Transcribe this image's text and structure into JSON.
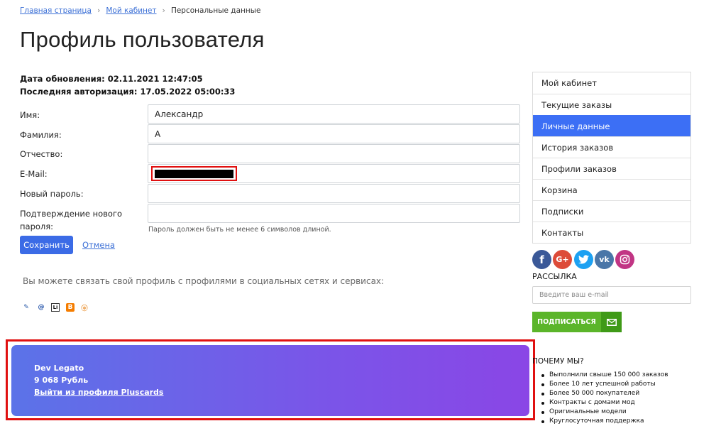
{
  "breadcrumb": {
    "home": "Главная страница",
    "cabinet": "Мой кабинет",
    "current": "Персональные данные"
  },
  "page_title": "Профиль пользователя",
  "meta": {
    "updated": "Дата обновления: 02.11.2021 12:47:05",
    "last_login": "Последняя авторизация: 17.05.2022 05:00:33"
  },
  "form": {
    "name_label": "Имя:",
    "name_value": "Александр",
    "surname_label": "Фамилия:",
    "surname_value": "А",
    "patronymic_label": "Отчество:",
    "patronymic_value": "",
    "email_label": "E-Mail:",
    "new_password_label": "Новый пароль:",
    "confirm_label_1": "Подтверждение нового",
    "confirm_label_2": "пароля:",
    "password_hint": "Пароль должен быть не менее 6 символов длиной.",
    "save": "Сохранить",
    "cancel": "Отмена"
  },
  "social": {
    "text": "Вы можете связать свой профиль с профилями в социальных сетях и сервисах:",
    "services": [
      "livejournal-icon",
      "mailru-icon",
      "liveinternet-icon",
      "blogger-icon",
      "openid-icon"
    ]
  },
  "profile_card": {
    "name": "Dev Legato",
    "balance": "9 068 Рубль",
    "logout": "Выйти из профиля Pluscards"
  },
  "sidebar": {
    "items": [
      {
        "label": "Мой кабинет"
      },
      {
        "label": "Текущие заказы"
      },
      {
        "label": "Личные данные",
        "active": true
      },
      {
        "label": "История заказов"
      },
      {
        "label": "Профили заказов"
      },
      {
        "label": "Корзина"
      },
      {
        "label": "Подписки"
      },
      {
        "label": "Контакты"
      }
    ],
    "social_links": [
      {
        "icon": "facebook-icon",
        "glyph": "f",
        "color": "#3b5998"
      },
      {
        "icon": "google-plus-icon",
        "glyph": "G+",
        "color": "#dd4b39"
      },
      {
        "icon": "twitter-icon",
        "glyph": "t",
        "color": "#1da1f2"
      },
      {
        "icon": "vk-icon",
        "glyph": "vk",
        "color": "#4a76a8"
      },
      {
        "icon": "instagram-icon",
        "glyph": "◎",
        "color": "#c13584"
      }
    ],
    "newsletter_title": "РАССЫЛКА",
    "email_placeholder": "Введите ваш e-mail",
    "subscribe": "ПОДПИСАТЬСЯ",
    "why_title": "ПОЧЕМУ МЫ?",
    "why": [
      "Выполнили свыше 150 000 заказов",
      "Более 10 лет успешной работы",
      "Более 50 000 покупателей",
      "Контракты с домами мод",
      "Оригинальные модели",
      "Круглосуточная поддержка"
    ]
  },
  "colors": {
    "accent": "#3c6ff5",
    "subscribe": "#5bb52a",
    "highlight": "#e01010"
  }
}
